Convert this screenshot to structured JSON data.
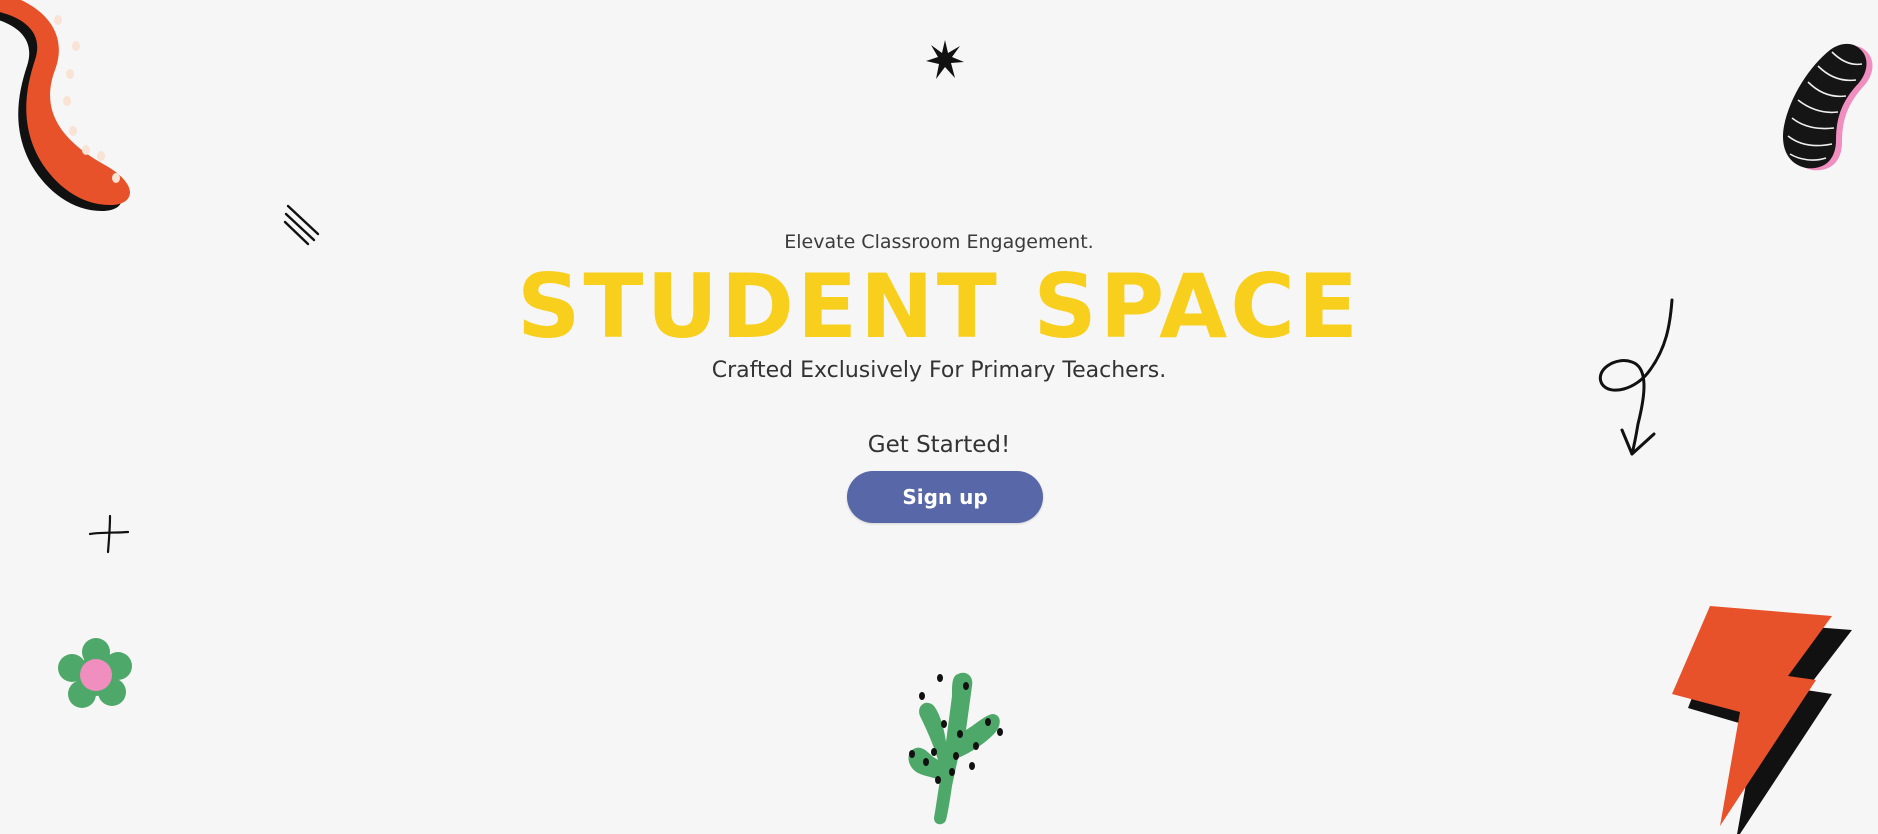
{
  "hero": {
    "tagline": "Elevate Classroom Engagement.",
    "title": "STUDENT SPACE",
    "subtitle": "Crafted Exclusively For Primary Teachers.",
    "cta_text": "Get Started!",
    "signup_label": "Sign up"
  },
  "colors": {
    "background": "#f6f6f6",
    "title": "#f8cf1d",
    "button": "#5767a7",
    "orange": "#e8522b",
    "green": "#4ea86a",
    "pink": "#ef8ebf"
  },
  "decorations": [
    "squiggle-doodle-icon",
    "star-doodle-icon",
    "worm-doodle-icon",
    "scratch-lines-icon",
    "loop-arrow-icon",
    "sparkle-cross-icon",
    "flower-icon",
    "cactus-icon",
    "lightning-bolt-icon"
  ]
}
